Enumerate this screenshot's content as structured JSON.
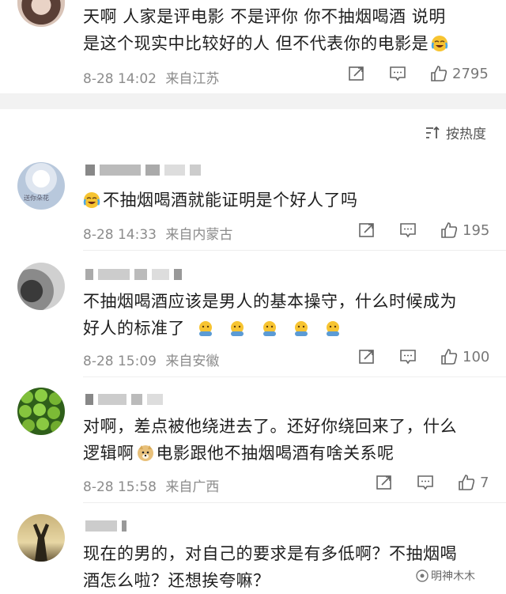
{
  "top_comment": {
    "text_line1": "天啊 人家是评电影 不是评你 你不抽烟喝酒 说明",
    "text_line2": "是这个现实中比较好的人 但不代表你的电影是",
    "time": "8-28 14:02",
    "location": "来自江苏",
    "likes": "2795"
  },
  "sort": {
    "label": "按热度",
    "icon": "sort-icon"
  },
  "comments": [
    {
      "text_line1": "不抽烟喝酒就能证明是个好人了吗",
      "time": "8-28 14:33",
      "location": "来自内蒙古",
      "likes": "195",
      "avatar_caption": "送你朵花"
    },
    {
      "text_line1": "不抽烟喝酒应该是男人的基本操守，什么时候成为",
      "text_line2": "好人的标准了",
      "time": "8-28 15:09",
      "location": "来自安徽",
      "likes": "100"
    },
    {
      "text_line1": "对啊，差点被他绕进去了。还好你绕回来了，什么",
      "text_line2a": "逻辑啊",
      "text_line2b": "电影跟他不抽烟喝酒有啥关系呢",
      "time": "8-28 15:58",
      "location": "来自广西",
      "likes": "7"
    },
    {
      "text_line1": "现在的男的，对自己的要求是有多低啊？不抽烟喝",
      "text_line2": "酒怎么啦？还想挨夸嘛？"
    }
  ],
  "watermark": {
    "text": "明神木木"
  },
  "colors": {
    "band": "#f2f2f2",
    "meta": "#8c8c8c",
    "text": "#1e1e1e"
  }
}
